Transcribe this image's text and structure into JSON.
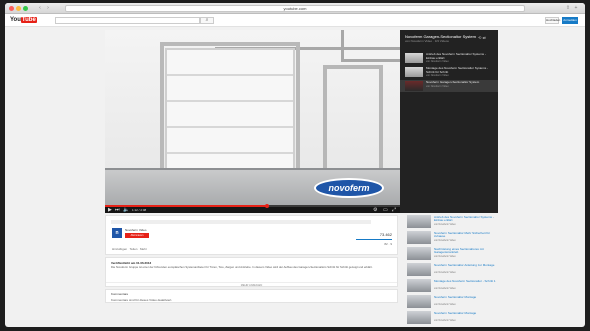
{
  "browser": {
    "url": "youtube.com",
    "back_icon": "back-arrow",
    "forward_icon": "forward-arrow"
  },
  "header": {
    "logo_you": "You",
    "logo_tube": "Tube",
    "search_placeholder": "",
    "upload_label": "Hochladen",
    "signin_label": "Anmelden"
  },
  "player": {
    "brand_label": "novoferm",
    "progress": 0.55,
    "play_icon": "play-icon",
    "time_label": "1:12 / 2:08"
  },
  "playlist": {
    "title": "Novoferm Garagen-Sectionaltor System",
    "subtitle": "von Novoferm Video · 3/4 Videos",
    "items": [
      {
        "title": "Antrieb des Novoferm Sectionaltor Systems - Einbau erklärt",
        "channel": "von Novoferm Video"
      },
      {
        "title": "Montage des Novoferm Sectionaltor Systems - Schritt für Schritt",
        "channel": "von Novoferm Video"
      },
      {
        "title": "Novoferm Garagen-Sectionaltor System",
        "channel": "von Novoferm Video"
      }
    ]
  },
  "video": {
    "channel_name": "Novoferm Video",
    "subscribe_label": "Abonnieren",
    "views": "73.462",
    "likes": "82  ·  9",
    "actions": [
      "Hinzufügen",
      "Teilen",
      "Mehr"
    ],
    "published": "Veröffentlicht am 01.06.2013",
    "description": "Die Novoferm Gruppe ist einer der führenden europäischen Systemanbieter für Türen, Tore, Zargen und Antriebe. In diesem Video wird der Aufbau des Garagen-Sectionaltors Schritt für Schritt gezeigt und erklärt.",
    "more_label": "MEHR ANZEIGEN"
  },
  "comments": {
    "heading": "Kommentare",
    "text": "Kommentare sind für dieses Video deaktiviert."
  },
  "recommendations": [
    {
      "title": "Antrieb des Novoferm Sectionaltor Systems - Einbau erklärt",
      "meta": "von Novoferm Video"
    },
    {
      "title": "Novoferm Sectionaltor Mehr Sicherheit für zuhause",
      "meta": "von Novoferm Video"
    },
    {
      "title": "Nachrüstung eines Sectionaltores mit Garagentorantrieb",
      "meta": "von Novoferm Video"
    },
    {
      "title": "Novoferm Sectionaltor Anleitung zur Montage",
      "meta": "von Novoferm Video"
    },
    {
      "title": "Montage des Novoferm Sectionaltor - Schritt 1",
      "meta": "von Novoferm Video"
    },
    {
      "title": "Novoferm Sectionaltor Montage",
      "meta": "von Novoferm Video"
    },
    {
      "title": "Novoferm Sectionaltor Montage",
      "meta": "von Novoferm Video"
    }
  ],
  "colors": {
    "accent": "#e62117",
    "link": "#167ac6",
    "brand": "#1f56a8"
  }
}
